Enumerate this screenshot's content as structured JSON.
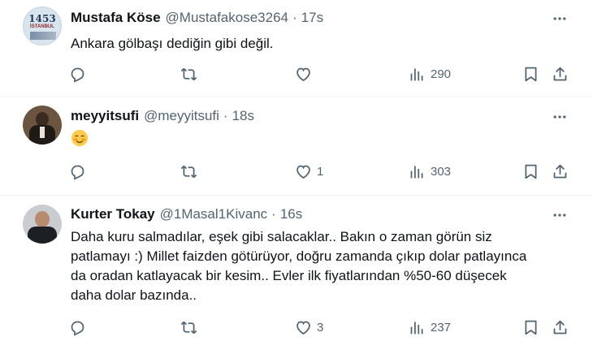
{
  "tweets": [
    {
      "name": "Mustafa Köse",
      "handle": "@Mustafakose3264",
      "time": "17s",
      "text": "Ankara gölbaşı dediğin gibi değil.",
      "avatar_text": "1453",
      "avatar_sub": "İSTANBUL",
      "reply_count": "",
      "retweet_count": "",
      "like_count": "",
      "views": "290"
    },
    {
      "name": "meyyitsufi",
      "handle": "@meyyitsufi",
      "time": "18s",
      "text": "",
      "emoji": "smiling-face-with-blush",
      "reply_count": "",
      "retweet_count": "",
      "like_count": "1",
      "views": "303"
    },
    {
      "name": "Kurter Tokay",
      "handle": "@1Masal1Kivanc",
      "time": "16s",
      "text_lines": [
        "Daha kuru salmadılar, eşek gibi salacaklar.. Bakın o zaman görün siz",
        "patlamayı :) Millet faizden götürüyor, doğru zamanda çıkıp dolar patlayınca",
        "da oradan katlayacak bir kesim.. Evler ilk fiyatlarından %50-60 düşecek",
        "daha dolar bazında.."
      ],
      "reply_count": "",
      "retweet_count": "",
      "like_count": "3",
      "views": "237"
    }
  ],
  "separator": "·",
  "colors": {
    "text": "#0f1419",
    "secondary": "#536471",
    "border": "#eff3f4"
  },
  "icons": [
    "reply-icon",
    "retweet-icon",
    "like-icon",
    "views-icon",
    "bookmark-icon",
    "share-icon",
    "more-icon"
  ]
}
